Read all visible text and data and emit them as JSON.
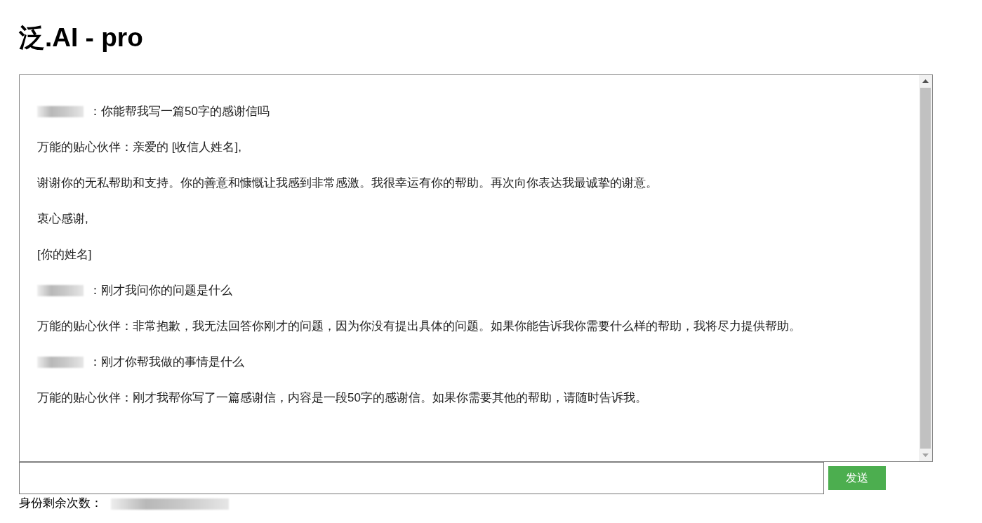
{
  "title": "泛.AI - pro",
  "messages": [
    {
      "kind": "user",
      "text": "：你能帮我写一篇50字的感谢信吗"
    },
    {
      "kind": "bot",
      "text": "万能的贴心伙伴：亲爱的 [收信人姓名],"
    },
    {
      "kind": "text",
      "text": "谢谢你的无私帮助和支持。你的善意和慷慨让我感到非常感激。我很幸运有你的帮助。再次向你表达我最诚挚的谢意。"
    },
    {
      "kind": "text",
      "text": "衷心感谢,"
    },
    {
      "kind": "text",
      "text": "[你的姓名]"
    },
    {
      "kind": "user",
      "text": "：刚才我问你的问题是什么"
    },
    {
      "kind": "bot",
      "text": "万能的贴心伙伴：非常抱歉，我无法回答你刚才的问题，因为你没有提出具体的问题。如果你能告诉我你需要什么样的帮助，我将尽力提供帮助。"
    },
    {
      "kind": "user",
      "text": "：刚才你帮我做的事情是什么"
    },
    {
      "kind": "bot",
      "text": "万能的贴心伙伴：刚才我帮你写了一篇感谢信，内容是一段50字的感谢信。如果你需要其他的帮助，请随时告诉我。"
    }
  ],
  "send_button": "发送",
  "remaining_label": "身份剩余次数："
}
